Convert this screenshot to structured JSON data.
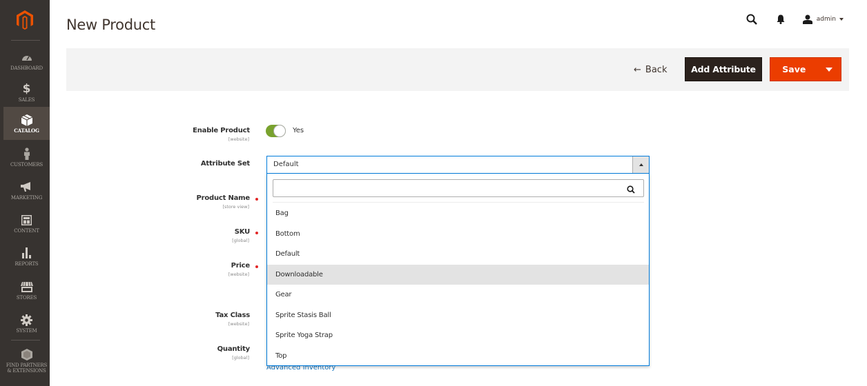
{
  "sidebar": {
    "logo": "magento-logo",
    "items": [
      {
        "label": "Dashboard",
        "icon": "dashboard-icon",
        "active": false
      },
      {
        "label": "Sales",
        "icon": "dollar-icon",
        "active": false
      },
      {
        "label": "Catalog",
        "icon": "cube-icon",
        "active": true
      },
      {
        "label": "Customers",
        "icon": "person-icon",
        "active": false
      },
      {
        "label": "Marketing",
        "icon": "megaphone-icon",
        "active": false
      },
      {
        "label": "Content",
        "icon": "layout-icon",
        "active": false
      },
      {
        "label": "Reports",
        "icon": "bar-chart-icon",
        "active": false
      },
      {
        "label": "Stores",
        "icon": "storefront-icon",
        "active": false
      },
      {
        "label": "System",
        "icon": "gear-icon",
        "active": false
      },
      {
        "label": "Find Partners & Extensions",
        "icon": "hexagon-cube-icon",
        "active": false
      }
    ]
  },
  "header": {
    "title": "New Product",
    "search_icon": "search-icon",
    "notifications_icon": "bell-icon",
    "user_label": "admin"
  },
  "actions": {
    "back_label": "Back",
    "add_attribute_label": "Add Attribute",
    "save_label": "Save"
  },
  "form": {
    "enable_product": {
      "label": "Enable Product",
      "scope": "[website]",
      "value": "Yes",
      "enabled": true
    },
    "attribute_set": {
      "label": "Attribute Set",
      "value": "Default"
    },
    "product_name": {
      "label": "Product Name",
      "scope": "[store view]",
      "required": true
    },
    "sku": {
      "label": "SKU",
      "scope": "[global]",
      "required": true
    },
    "price": {
      "label": "Price",
      "scope": "[website]",
      "required": true
    },
    "tax_class": {
      "label": "Tax Class",
      "scope": "[website]"
    },
    "quantity": {
      "label": "Quantity",
      "scope": "[global]"
    },
    "advanced_inventory_link": "Advanced Inventory"
  },
  "dropdown": {
    "search_value": "",
    "search_placeholder": "",
    "options": [
      "Bag",
      "Bottom",
      "Default",
      "Downloadable",
      "Gear",
      "Sprite Stasis Ball",
      "Sprite Yoga Strap",
      "Top"
    ],
    "hovered": "Downloadable"
  },
  "colors": {
    "sidebar_bg": "#373330",
    "sidebar_active": "#514943",
    "brand_orange": "#eb5202",
    "save_button": "#eb3d00",
    "dark_button": "#2b221d",
    "toggle_on": "#79a22e",
    "focus_border": "#007bdb",
    "link": "#1979c3"
  }
}
